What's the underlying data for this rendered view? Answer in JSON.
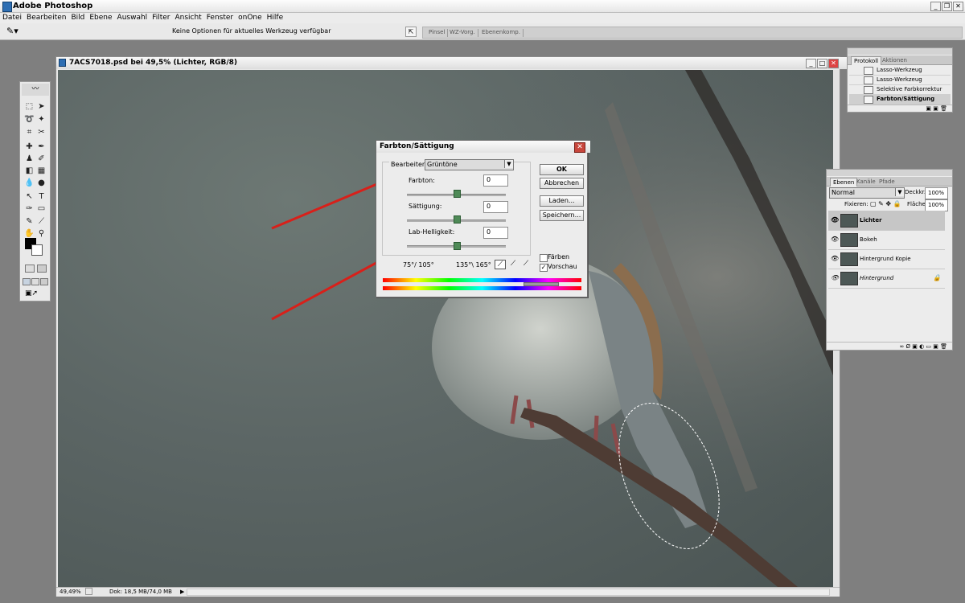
{
  "app": {
    "title": "Adobe Photoshop",
    "window_buttons": [
      "_",
      "❐",
      "✕"
    ]
  },
  "menubar": [
    "Datei",
    "Bearbeiten",
    "Bild",
    "Ebene",
    "Auswahl",
    "Filter",
    "Ansicht",
    "Fenster",
    "onOne",
    "Hilfe"
  ],
  "options_bar": {
    "hint": "Keine Optionen für aktuelles Werkzeug verfügbar",
    "palette_well_tabs": [
      "Pinsel",
      "WZ-Vorg.",
      "Ebenenkomp."
    ]
  },
  "document": {
    "title": "7ACS7018.psd bei 49,5% (Lichter, RGB/8)",
    "zoom": "49,49%",
    "doc_info": "Dok: 18,5 MB/74,0 MB"
  },
  "hue_saturation_dialog": {
    "title": "Farbton/Sättigung",
    "edit_label": "Bearbeiten:",
    "edit_value": "Grüntöne",
    "hue_label": "Farbton:",
    "hue_value": "0",
    "saturation_label": "Sättigung:",
    "saturation_value": "0",
    "lightness_label": "Lab-Helligkeit:",
    "lightness_value": "0",
    "range_left": "75°/ 105°",
    "range_right": "135°\\ 165°",
    "ok": "OK",
    "cancel": "Abbrechen",
    "load": "Laden...",
    "save": "Speichern...",
    "colorize": "Färben",
    "preview": "Vorschau",
    "preview_checked": "✓"
  },
  "history_panel": {
    "tabs": [
      "Protokoll",
      "Aktionen"
    ],
    "items": [
      "Lasso-Werkzeug",
      "Lasso-Werkzeug",
      "Selektive Farbkorrektur",
      "Farbton/Sättigung"
    ]
  },
  "layers_panel": {
    "tabs": [
      "Ebenen",
      "Kanäle",
      "Pfade"
    ],
    "blend_mode": "Normal",
    "opacity_label": "Deckkr.:",
    "opacity_value": "100%",
    "lock_label": "Fixieren:",
    "fill_label": "Fläche:",
    "fill_value": "100%",
    "layers": [
      "Lichter",
      "Bokeh",
      "Hintergrund Kopie",
      "Hintergrund"
    ]
  },
  "colors": {
    "arrow": "#d8201a",
    "canvas_bg": "#56605f"
  }
}
